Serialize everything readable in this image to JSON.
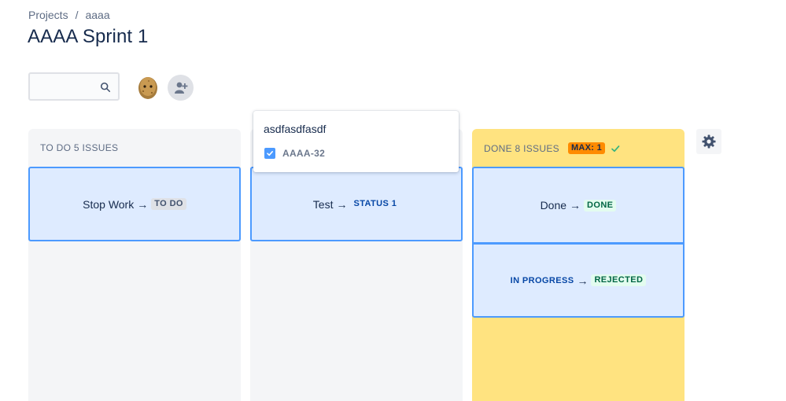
{
  "breadcrumb": {
    "items": [
      "Projects",
      "aaaa"
    ],
    "separator": "/"
  },
  "page_title": "AAAA Sprint 1",
  "search": {
    "value": "",
    "placeholder": ""
  },
  "icons": {
    "search": "search-icon",
    "avatar": "potato-avatar",
    "add_person": "add-person-icon",
    "settings": "gear-icon",
    "checkbox": "checkbox-checked-icon",
    "check": "check-icon"
  },
  "columns": [
    {
      "header": "TO DO 5 ISSUES",
      "cards": [
        {
          "from": "Stop Work",
          "arrow": "→",
          "to": "TO DO"
        }
      ]
    },
    {
      "header": "",
      "cards": [
        {
          "from": "Test",
          "arrow": "→",
          "to": "STATUS 1"
        }
      ]
    },
    {
      "header": "DONE 8 ISSUES",
      "max_badge": "MAX: 1",
      "cards": [
        {
          "from": "Done",
          "arrow": "→",
          "to": "DONE"
        },
        {
          "from": "IN PROGRESS",
          "arrow": "→",
          "to": "REJECTED"
        }
      ]
    }
  ],
  "popup": {
    "title": "asdfasdfasdf",
    "issue_key": "AAAA-32"
  },
  "colors": {
    "accent": "#4c9aff",
    "card_bg": "#deebff",
    "done_column": "#ffe380",
    "max_badge": "#ff8b00",
    "column_bg": "#f4f5f7"
  }
}
